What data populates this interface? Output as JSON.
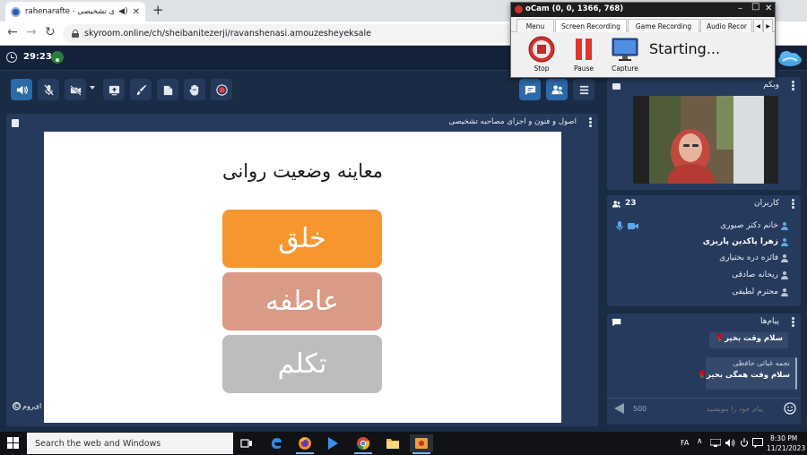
{
  "browser": {
    "tab_title": "rahenarafte - ﻫﻪ ی تشخیصی",
    "audio_icon": "speaker-icon",
    "close_icon": "close-icon",
    "new_tab_icon": "plus-icon",
    "url": "skyroom.online/ch/sheibanitezerji/ravanshenasi.amouzesheyeksale"
  },
  "header": {
    "timer": "29:23",
    "connection_icon": "wifi-icon",
    "logo_icon": "cloud-logo"
  },
  "toolbar": {
    "buttons": [
      {
        "name": "speaker-icon",
        "active": true
      },
      {
        "name": "mic-off-icon",
        "active": false
      },
      {
        "name": "camera-off-icon",
        "active": false
      },
      {
        "name": "screen-share-icon",
        "active": false
      },
      {
        "name": "brush-icon",
        "active": false
      },
      {
        "name": "file-icon",
        "active": false
      },
      {
        "name": "hand-icon",
        "active": false
      },
      {
        "name": "record-icon",
        "active": false
      },
      {
        "name": "chat-icon",
        "active": true
      },
      {
        "name": "users-icon",
        "active": true
      },
      {
        "name": "menu-icon",
        "active": false
      }
    ]
  },
  "presentation": {
    "panel_title": "اصول و فنون و اجزای مصاحبه تشخیصی",
    "slide_heading": "معاینه وضعیت روانی",
    "boxes": [
      {
        "label": "خلق",
        "color": "#f7962f"
      },
      {
        "label": "عاطفه",
        "color": "#d99a86"
      },
      {
        "label": "تکلم",
        "color": "#bdbdbd"
      }
    ],
    "brand": "ای‌روم"
  },
  "webcam_panel": {
    "title": "وبکم"
  },
  "users_panel": {
    "title": "کاربران",
    "count": "23",
    "users": [
      {
        "name": "خانم دکتر صبوری",
        "bold": false,
        "icon_color": "#5aa9e6"
      },
      {
        "name": "زهرا پاکدین پاریزی",
        "bold": true,
        "icon_color": "#5aa9e6"
      },
      {
        "name": "فائزه دره بختیاری",
        "bold": false,
        "icon_color": "#b9c3d2"
      },
      {
        "name": "ریحانه صادقی",
        "bold": false,
        "icon_color": "#b9c3d2"
      },
      {
        "name": "محترم لطیفی",
        "bold": false,
        "icon_color": "#b9c3d2"
      }
    ]
  },
  "messages_panel": {
    "title": "پیام‌ها",
    "messages": [
      {
        "sender": "",
        "text": "سلام وقت بخیر🌹"
      },
      {
        "sender": "نجمه غیاثی حافظی",
        "text": "سلام وقت همگی بخیر🌹"
      }
    ],
    "input_placeholder": "پیام خود را بنویسید",
    "char_limit": "500"
  },
  "ocam": {
    "title": "oCam (0, 0, 1366, 768)",
    "tabs": [
      "Menu",
      "Screen Recording",
      "Game Recording",
      "Audio Recor"
    ],
    "selected_tab": 1,
    "buttons": [
      "Stop",
      "Pause",
      "Capture"
    ],
    "status": "Starting..."
  },
  "taskbar": {
    "search_placeholder": "Search the web and Windows",
    "language": "FA",
    "time": "8:30 PM",
    "date": "11/21/2023"
  }
}
